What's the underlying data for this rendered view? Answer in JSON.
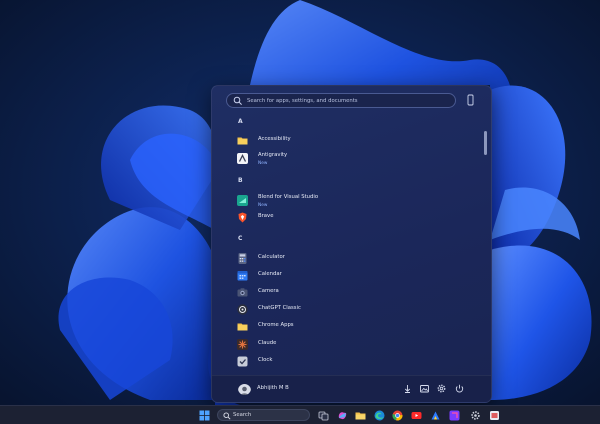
{
  "search": {
    "placeholder": "Search for apps, settings, and documents"
  },
  "sections": [
    {
      "letter": "A",
      "apps": [
        {
          "name": "Accessibility",
          "icon": "folder-icon"
        },
        {
          "name": "Antigravity",
          "badge": "New",
          "icon": "antigravity-icon"
        }
      ]
    },
    {
      "letter": "B",
      "apps": [
        {
          "name": "Blend for Visual Studio",
          "badge": "New",
          "icon": "blend-icon"
        },
        {
          "name": "Brave",
          "icon": "brave-icon"
        }
      ]
    },
    {
      "letter": "C",
      "apps": [
        {
          "name": "Calculator",
          "icon": "calculator-icon"
        },
        {
          "name": "Calendar",
          "icon": "calendar-icon"
        },
        {
          "name": "Camera",
          "icon": "camera-icon"
        },
        {
          "name": "ChatGPT Classic",
          "icon": "chatgpt-icon"
        },
        {
          "name": "Chrome Apps",
          "icon": "folder-icon"
        },
        {
          "name": "Claude",
          "icon": "claude-icon"
        },
        {
          "name": "Clock",
          "icon": "clock-icon"
        }
      ]
    }
  ],
  "user": {
    "name": "Abhijith M B"
  },
  "taskbar": {
    "search_label": "Search"
  },
  "colors": {
    "accent": "#3b6cf6",
    "panel": "#1f2d60",
    "taskbar": "#1c2133"
  }
}
